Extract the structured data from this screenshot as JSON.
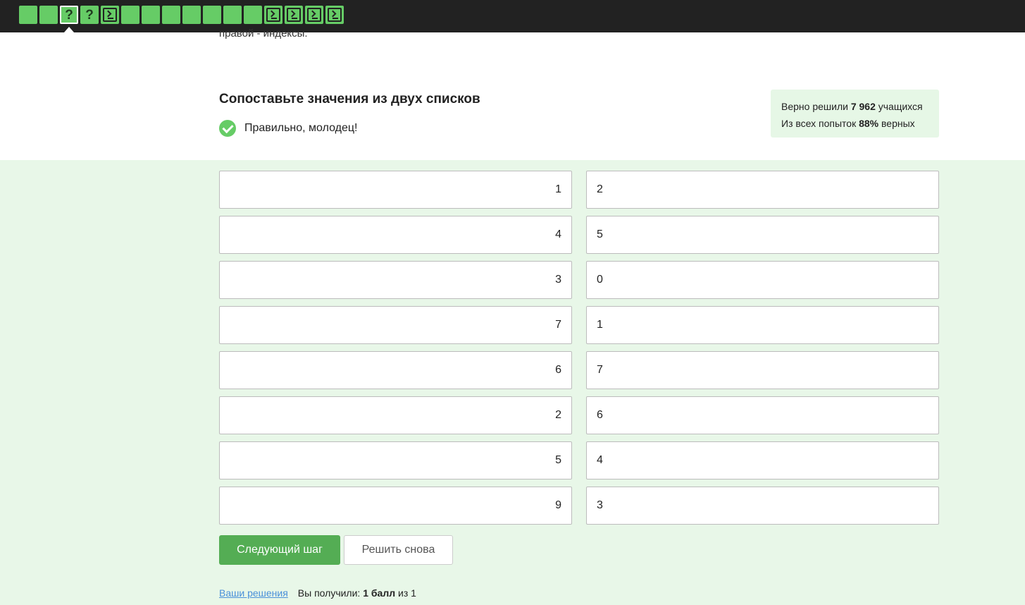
{
  "steps": [
    {
      "kind": "done"
    },
    {
      "kind": "done"
    },
    {
      "kind": "question",
      "glyph": "?",
      "active": true
    },
    {
      "kind": "question",
      "glyph": "?"
    },
    {
      "kind": "code"
    },
    {
      "kind": "done"
    },
    {
      "kind": "done"
    },
    {
      "kind": "done"
    },
    {
      "kind": "done"
    },
    {
      "kind": "done"
    },
    {
      "kind": "done"
    },
    {
      "kind": "done"
    },
    {
      "kind": "code"
    },
    {
      "kind": "code"
    },
    {
      "kind": "code"
    },
    {
      "kind": "code"
    }
  ],
  "previous_text": "правой - индексы.",
  "task": {
    "title": "Сопоставьте значения из двух списков",
    "status_text": "Правильно, молодец!"
  },
  "stats": {
    "line1_prefix": "Верно решили ",
    "solved_count": "7 962",
    "line1_suffix": " учащихся",
    "line2_prefix": "Из всех попыток ",
    "percent": "88%",
    "line2_suffix": " верных"
  },
  "pairs": [
    {
      "left": "1",
      "right": "2"
    },
    {
      "left": "4",
      "right": "5"
    },
    {
      "left": "3",
      "right": "0"
    },
    {
      "left": "7",
      "right": "1"
    },
    {
      "left": "6",
      "right": "7"
    },
    {
      "left": "2",
      "right": "6"
    },
    {
      "left": "5",
      "right": "4"
    },
    {
      "left": "9",
      "right": "3"
    }
  ],
  "buttons": {
    "next": "Следующий шаг",
    "retry": "Решить снова"
  },
  "footer": {
    "solutions_link": "Ваши решения",
    "score_prefix": "Вы получили: ",
    "score_value": "1 балл",
    "score_suffix": " из 1"
  },
  "colors": {
    "topbar": "#222222",
    "step_green": "#66cc66",
    "answer_bg": "#e8f7e8",
    "stats_bg": "#e6f7e6",
    "primary_button": "#54ad54",
    "link": "#4a90d9"
  }
}
